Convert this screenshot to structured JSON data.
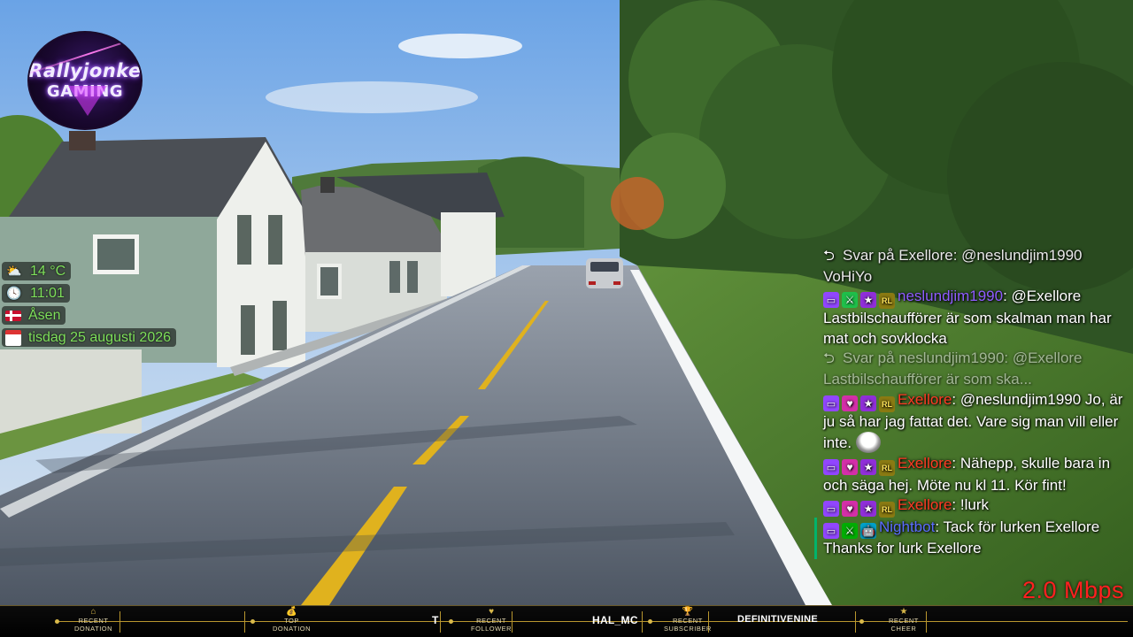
{
  "logo": {
    "line1": "Rallyjonke",
    "line2": "GAMING"
  },
  "info": {
    "weather": {
      "icon": "weather-partly-cloudy-icon",
      "text": "14 °C"
    },
    "time": {
      "icon": "clock-icon",
      "text": "11:01"
    },
    "location": {
      "icon": "norway-flag-icon",
      "text": "Åsen"
    },
    "date": {
      "icon": "calendar-icon",
      "text": "tisdag 25 augusti 2026"
    }
  },
  "chat": {
    "messages": [
      {
        "type": "reply",
        "text": "Svar på Exellore: @neslundjim1990 VoHiYo"
      },
      {
        "user": "neslundjim1990",
        "text": ": @Exellore Lastbilschaufförer är som skalman man har mat och sovklocka"
      },
      {
        "type": "reply",
        "text": "Svar på neslundjim1990: @Exellore Lastbilschaufförer är som ska..."
      },
      {
        "user": "Exellore",
        "text": ": @neslundjim1990 Jo, är ju så har jag fattat det. Vare sig man vill eller inte."
      },
      {
        "user": "Exellore",
        "text": ": Nähepp, skulle bara in och säga hej. Möte nu kl 11. Kör fint!"
      },
      {
        "user": "Exellore",
        "text": ": !lurk"
      },
      {
        "user": "Nightbot",
        "text": ": Tack för lurken Exellore Thanks for lurk Exellore"
      }
    ]
  },
  "bitrate": "2.0 Mbps",
  "bottombar": {
    "items": [
      {
        "label1": "RECENT",
        "label2": "DONATION",
        "icon": "house-icon"
      },
      {
        "label1": "TOP",
        "label2": "DONATION",
        "icon": "money-bag-icon"
      },
      {
        "value": "T"
      },
      {
        "label1": "RECENT",
        "label2": "FOLLOWER",
        "icon": "heart-icon"
      },
      {
        "value": "HAL_MC"
      },
      {
        "label1": "RECENT",
        "label2": "SUBSCRIBER",
        "icon": "trophy-icon"
      },
      {
        "value": "DEFINITIVENINE"
      },
      {
        "label1": "RECENT",
        "label2": "CHEER",
        "icon": "star-icon"
      }
    ]
  },
  "colors": {
    "chat_name_blue": "#8f5cff",
    "chat_name_red": "#ff3a24",
    "info_text": "#7ee05b",
    "bitrate": "#ff2020",
    "gold": "#b8962e"
  }
}
